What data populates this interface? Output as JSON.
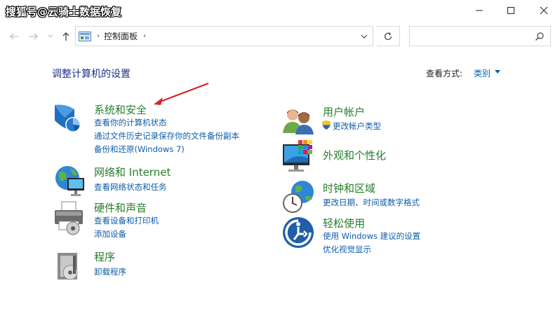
{
  "watermark": "搜狐号@云骑士数据恢复",
  "address": {
    "path": "控制面板",
    "search_placeholder": ""
  },
  "header": {
    "heading": "调整计算机的设置",
    "view_by_label": "查看方式:",
    "view_by_value": "类别"
  },
  "left": [
    {
      "title": "系统和安全",
      "icon": "shield-icon",
      "links": [
        "查看你的计算机状态",
        "通过文件历史记录保存你的文件备份副本",
        "备份和还原(Windows 7)"
      ]
    },
    {
      "title": "网络和 Internet",
      "icon": "network-globe-icon",
      "links": [
        "查看网络状态和任务"
      ]
    },
    {
      "title": "硬件和声音",
      "icon": "printer-icon",
      "links": [
        "查看设备和打印机",
        "添加设备"
      ]
    },
    {
      "title": "程序",
      "icon": "programs-icon",
      "links": [
        "卸载程序"
      ]
    }
  ],
  "right": [
    {
      "title": "用户帐户",
      "icon": "users-icon",
      "links": [
        "更改帐户类型"
      ]
    },
    {
      "title": "外观和个性化",
      "icon": "monitor-palette-icon",
      "links": []
    },
    {
      "title": "时钟和区域",
      "icon": "clock-globe-icon",
      "links": [
        "更改日期、时间或数字格式"
      ]
    },
    {
      "title": "轻松使用",
      "icon": "ease-of-access-icon",
      "links": [
        "使用 Windows 建议的设置",
        "优化视觉显示"
      ]
    }
  ],
  "colors": {
    "category_title": "#267d2c",
    "link": "#0d5cab",
    "heading": "#1e3287",
    "annotation_arrow": "#d0262a"
  }
}
